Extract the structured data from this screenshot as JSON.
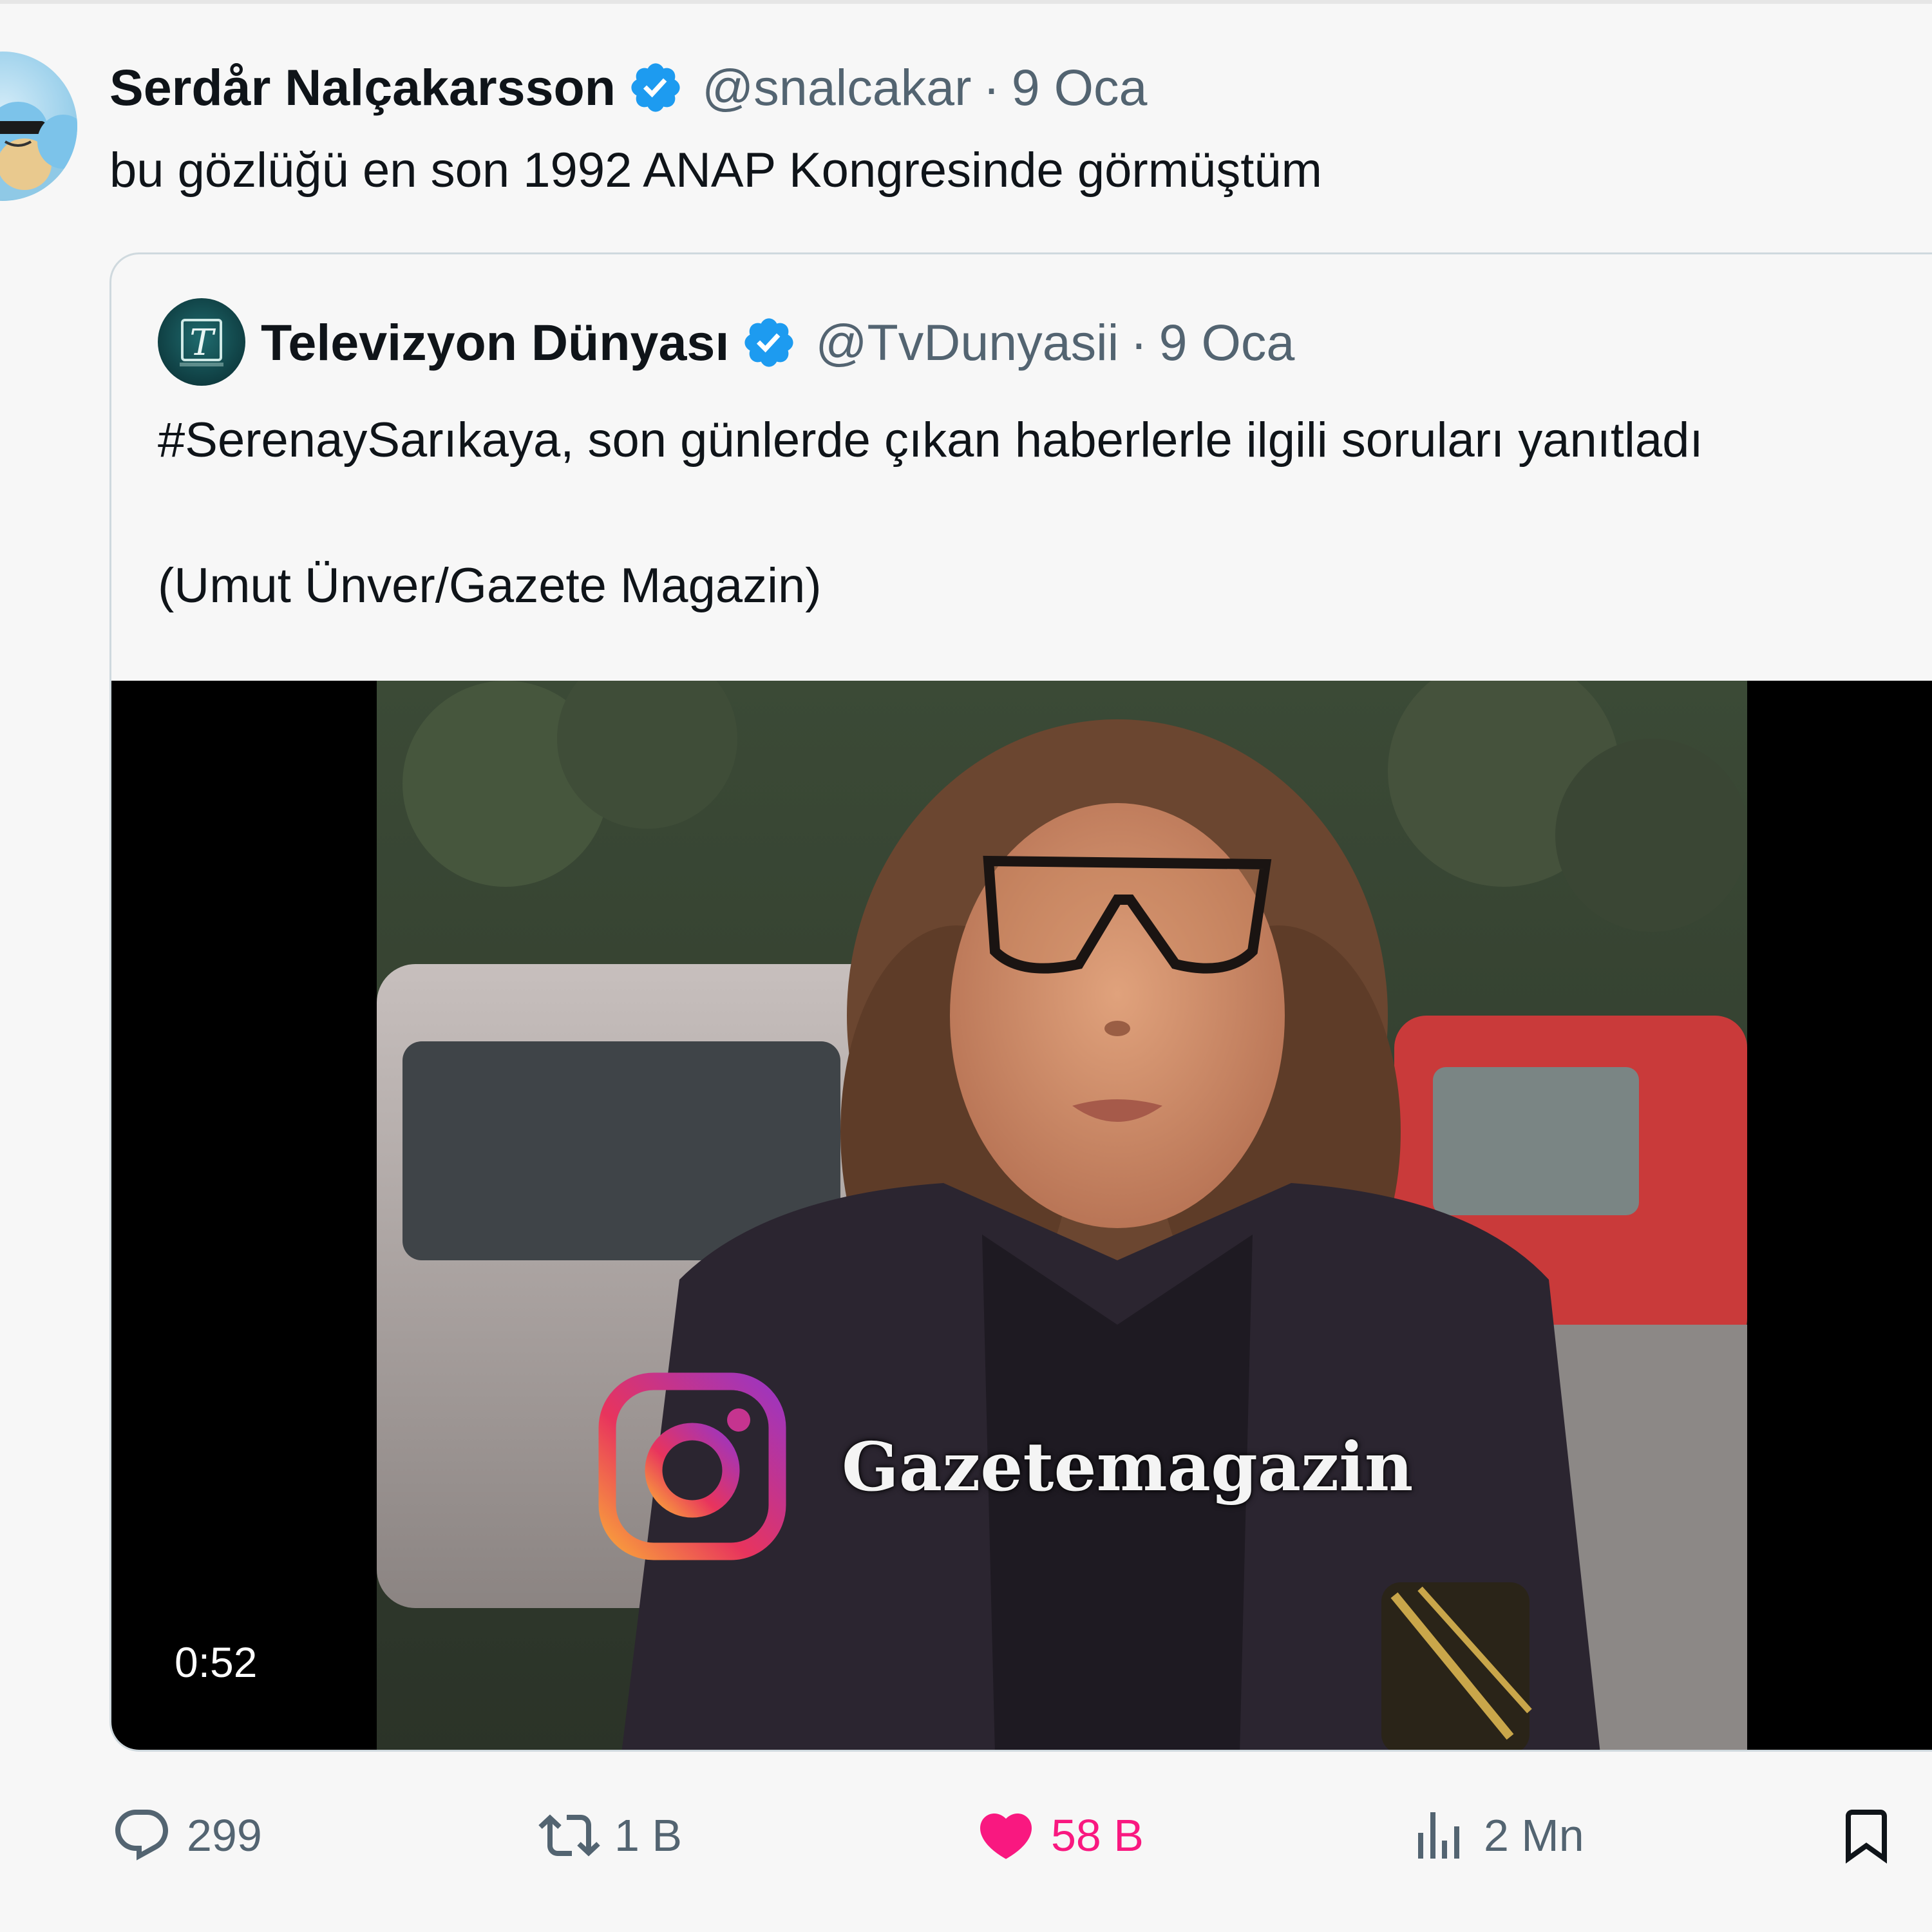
{
  "tweet": {
    "author_name": "Serdår Nalçakarsson",
    "handle": "@snalcakar",
    "separator": "·",
    "date": "9 Oca",
    "text": "bu gözlüğü en son 1992 ANAP Kongresinde görmüştüm",
    "verified": true,
    "avatar_icon": "squirtle-squad-avatar"
  },
  "quoted_tweet": {
    "author_name": "Televizyon Dünyası",
    "handle": "@TvDunyasii",
    "separator": "·",
    "date": "9 Oca",
    "text_line1": "#SerenaySarıkaya, son günlerde çıkan haberlerle ilgili soruları yanıtladı",
    "text_line2": "(Umut Ünver/Gazete Magazin)",
    "verified": true,
    "avatar_icon": "tv-letter-t-logo",
    "video": {
      "duration": "0:52",
      "overlay_text": "Gazetemagazin",
      "overlay_icon": "instagram-icon"
    }
  },
  "actions": {
    "reply": {
      "count": "299",
      "icon": "reply-icon"
    },
    "retweet": {
      "count": "1 B",
      "icon": "retweet-icon"
    },
    "like": {
      "count": "58 B",
      "icon": "heart-icon",
      "active": true
    },
    "views": {
      "count": "2 Mn",
      "icon": "views-icon"
    },
    "bookmark": {
      "icon": "bookmark-icon"
    }
  },
  "colors": {
    "verified_blue": "#1d9bf0",
    "like_pink": "#f91880",
    "secondary_text": "#536471",
    "background": "#f7f7f7"
  }
}
